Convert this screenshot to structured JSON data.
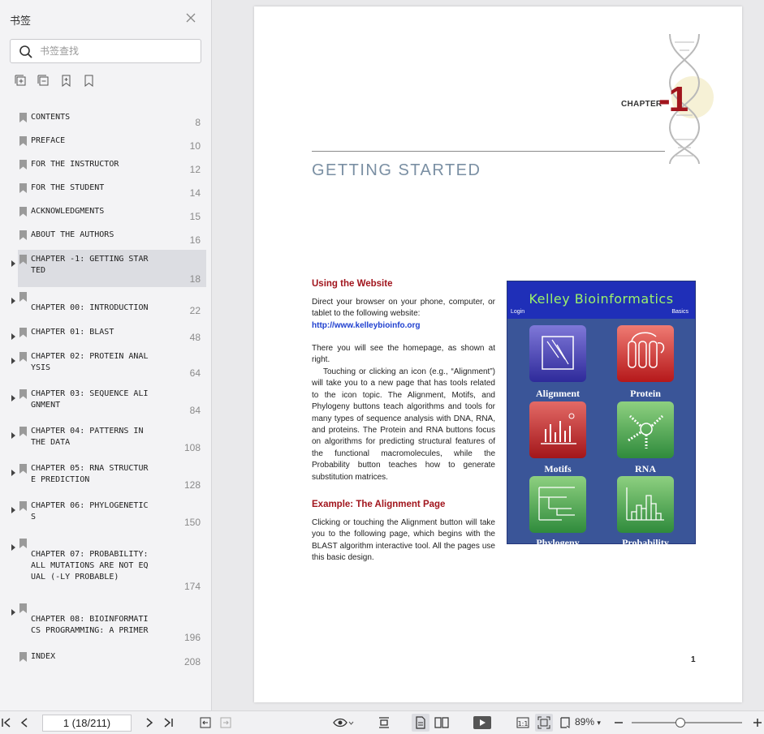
{
  "sidebar": {
    "title": "书签",
    "search_placeholder": "书签查找",
    "bookmarks": [
      {
        "label": "CONTENTS",
        "page": "8"
      },
      {
        "label": "PREFACE",
        "page": "10"
      },
      {
        "label": "FOR THE INSTRUCTOR",
        "page": "12"
      },
      {
        "label": "FOR THE STUDENT",
        "page": "14"
      },
      {
        "label": "ACKNOWLEDGMENTS",
        "page": "15"
      },
      {
        "label": "ABOUT THE AUTHORS",
        "page": "16"
      },
      {
        "label": "CHAPTER -1: GETTING STAR\nTED",
        "page": "18"
      },
      {
        "label": "\nCHAPTER 00: INTRODUCTION",
        "page": "22"
      },
      {
        "label": "CHAPTER 01: BLAST",
        "page": "48"
      },
      {
        "label": "CHAPTER 02: PROTEIN ANAL\nYSIS",
        "page": "64"
      },
      {
        "label": "CHAPTER 03: SEQUENCE ALI\nGNMENT",
        "page": "84"
      },
      {
        "label": "CHAPTER 04: PATTERNS IN\nTHE DATA",
        "page": "108"
      },
      {
        "label": "CHAPTER 05: RNA STRUCTUR\nE PREDICTION",
        "page": "128"
      },
      {
        "label": "CHAPTER 06: PHYLOGENETIC\nS",
        "page": "150"
      },
      {
        "label": "\nCHAPTER 07: PROBABILITY:\nALL MUTATIONS ARE NOT EQ\nUAL (-LY PROBABLE)",
        "page": "174"
      },
      {
        "label": "\nCHAPTER 08: BIOINFORMATI\nCS PROGRAMMING: A PRIMER",
        "page": "196"
      },
      {
        "label": "INDEX",
        "page": "208"
      }
    ]
  },
  "document": {
    "chapter_word": "CHAPTER",
    "chapter_number": "-1",
    "title": "GETTING STARTED",
    "section1_heading": "Using the Website",
    "section1_p1": "Direct your browser on your phone, computer, or tablet to the following website:",
    "section1_link": "http://www.kelleybioinfo.org",
    "section1_p2": "There you will see the homepage, as shown at right.",
    "section1_p3": "Touching or clicking an icon (e.g., “Alignment”) will take you to a new page that has tools related to the icon topic. The Alignment, Motifs, and Phylogeny buttons teach algorithms and tools for many types of sequence analysis with DNA, RNA, and proteins. The Protein and RNA buttons focus on algorithms for predicting structural features of the functional macromolecules, while the Probability button teaches how to generate substitution matrices.",
    "section2_heading": "Example: The Alignment Page",
    "section2_p1": "Clicking or touching the Alignment button will take you to the following page, which begins with the BLAST algorithm interactive tool. All the pages use this basic design.",
    "page_number": "1",
    "figure": {
      "title": "Kelley Bioinformatics",
      "login": "Login",
      "basics": "Basics",
      "tiles": [
        "Alignment",
        "Protein",
        "Motifs",
        "RNA",
        "Phylogeny",
        "Probability"
      ]
    }
  },
  "toolbar": {
    "page_indicator": "1 (18/211)",
    "zoom": "89%"
  },
  "colors": {
    "accent_red": "#a1151d",
    "title_blue_gray": "#7a8fa3",
    "link_blue": "#1e3fcf"
  }
}
